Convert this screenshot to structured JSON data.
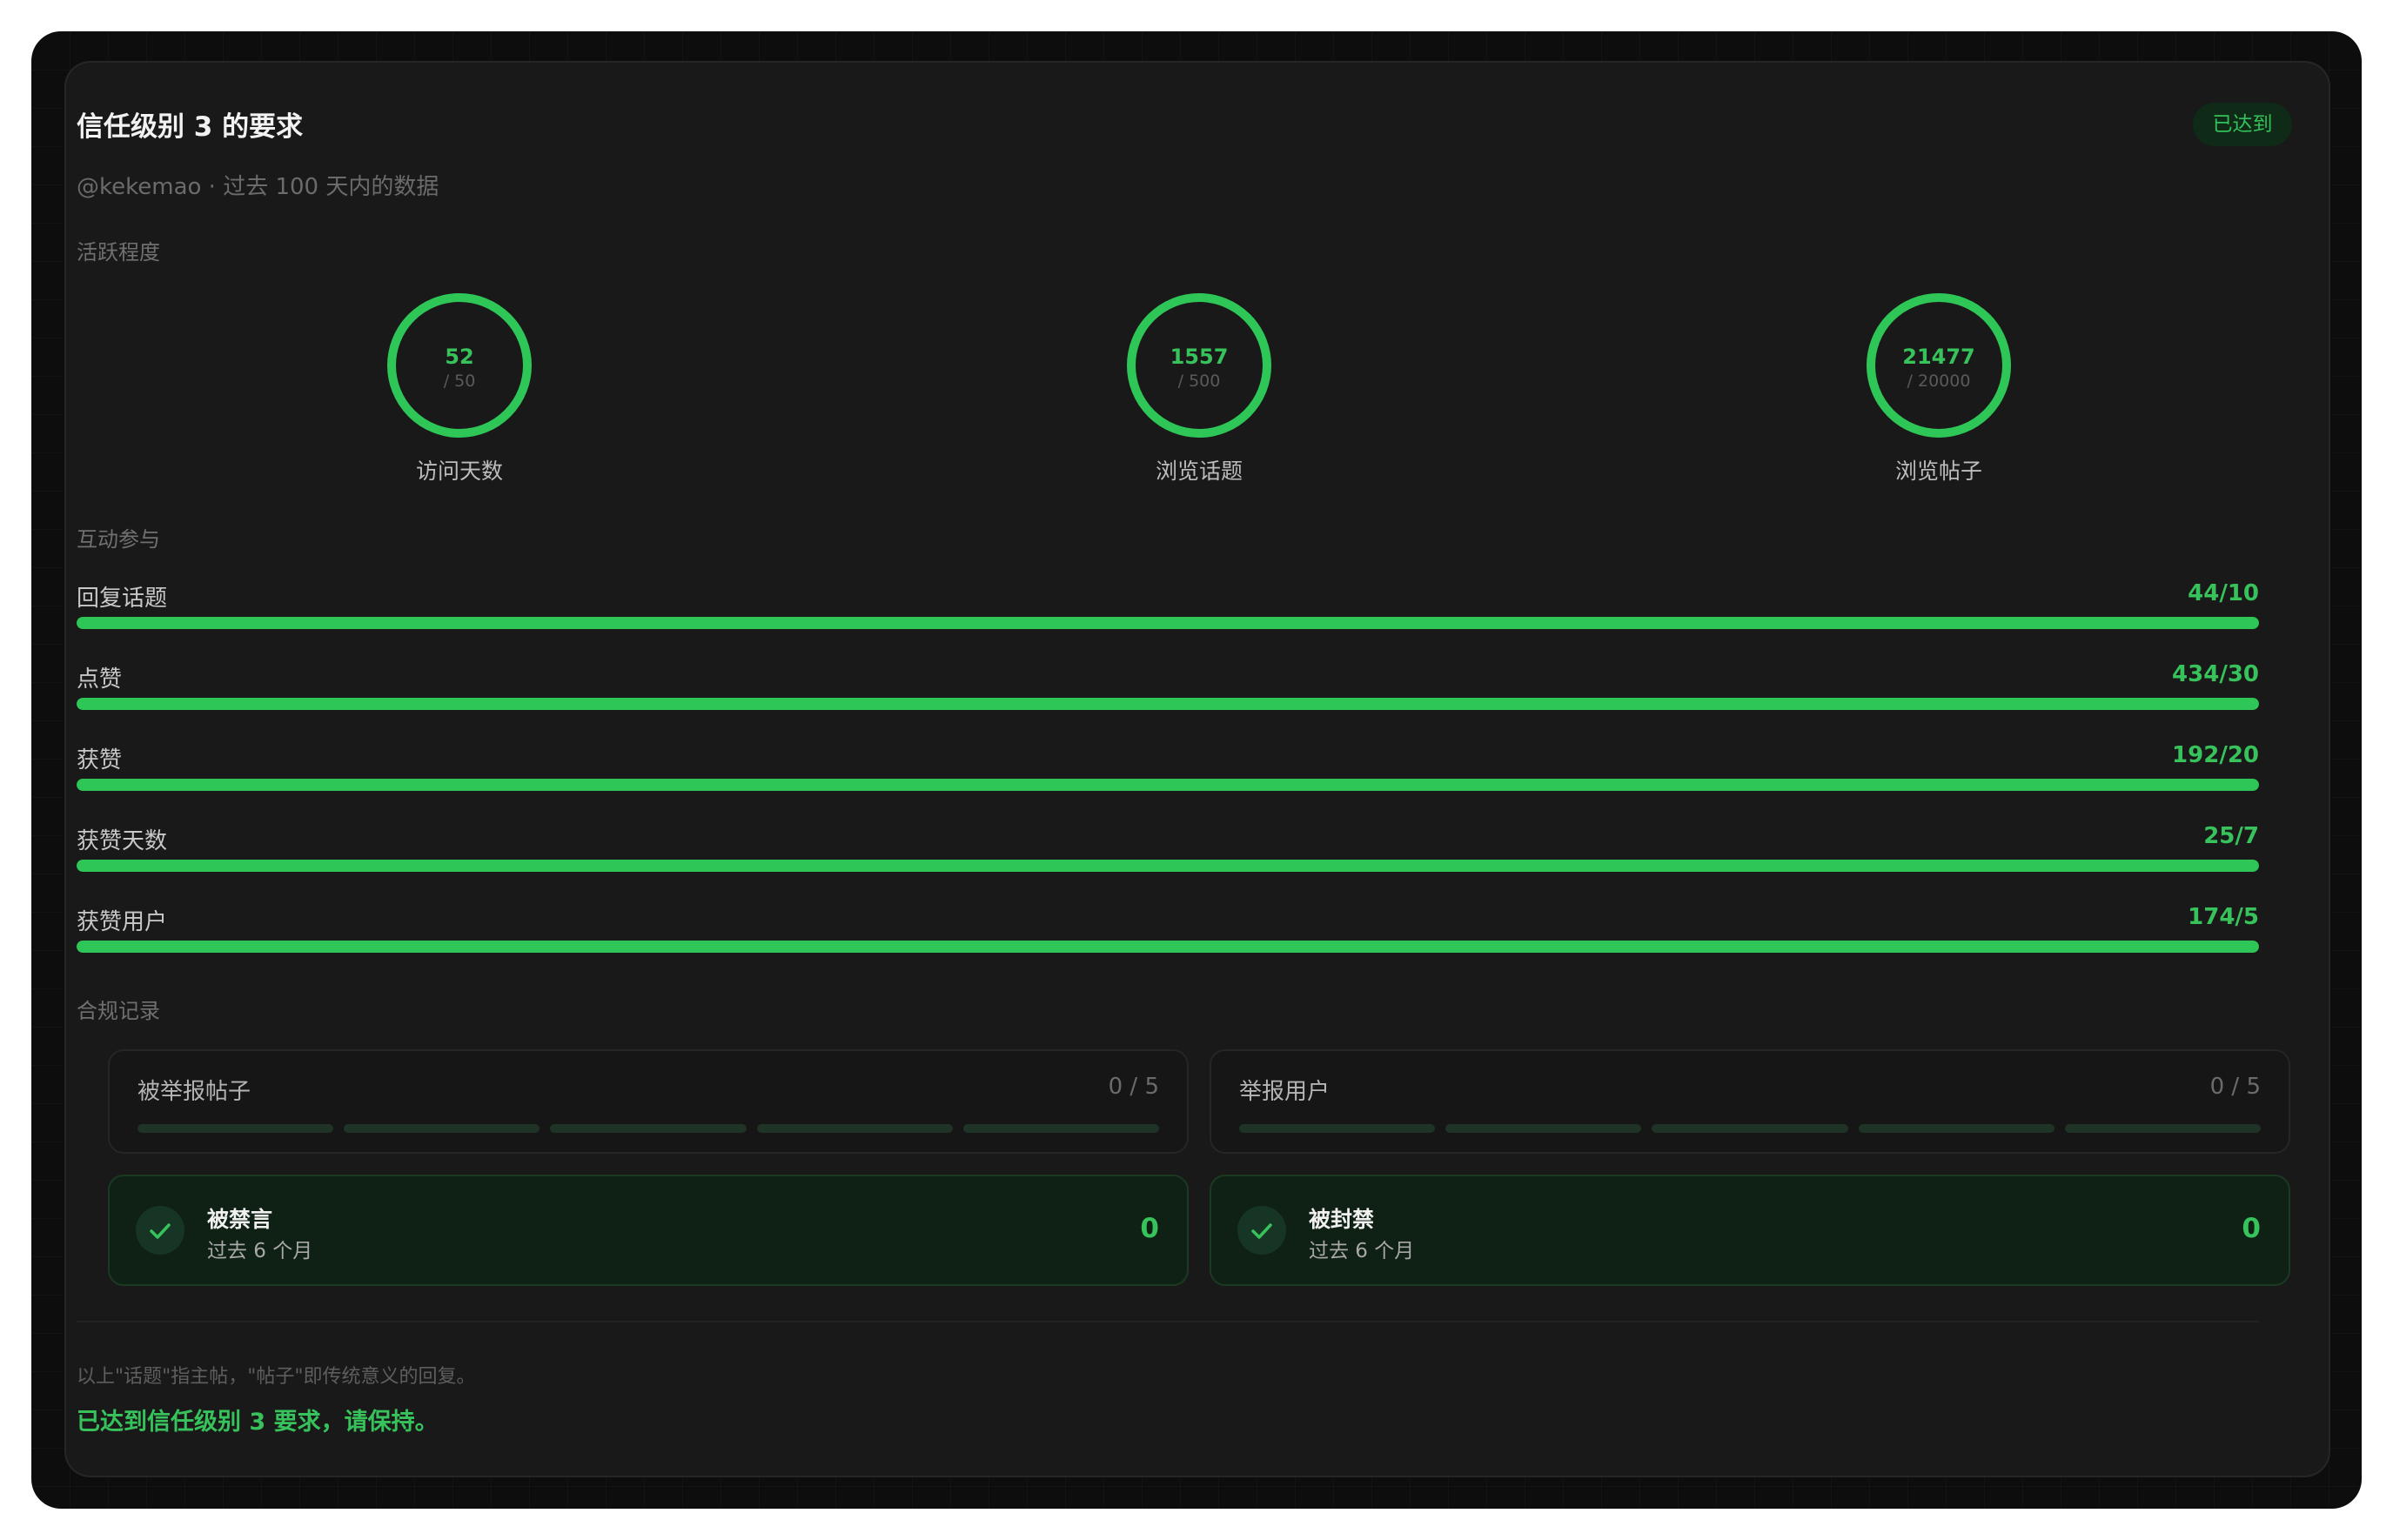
{
  "header": {
    "title": "信任级别 3 的要求",
    "badge": "已达到",
    "subtitle": "@kekemao · 过去 100 天内的数据"
  },
  "activity": {
    "label": "活跃程度",
    "rings": [
      {
        "value": "52",
        "goal": "/ 50",
        "label": "访问天数",
        "progress": 1.0
      },
      {
        "value": "1557",
        "goal": "/ 500",
        "label": "浏览话题",
        "progress": 1.0
      },
      {
        "value": "21477",
        "goal": "/ 20000",
        "label": "浏览帖子",
        "progress": 1.0
      }
    ]
  },
  "engagement": {
    "label": "互动参与",
    "bars": [
      {
        "name": "回复话题",
        "value": "44/10",
        "progress": 1.0
      },
      {
        "name": "点赞",
        "value": "434/30",
        "progress": 1.0
      },
      {
        "name": "获赞",
        "value": "192/20",
        "progress": 1.0
      },
      {
        "name": "获赞天数",
        "value": "25/7",
        "progress": 1.0
      },
      {
        "name": "获赞用户",
        "value": "174/5",
        "progress": 1.0
      }
    ]
  },
  "compliance": {
    "label": "合规记录",
    "flagged_posts": {
      "name": "被举报帖子",
      "value": "0 / 5"
    },
    "flagged_users": {
      "name": "举报用户",
      "value": "0 / 5"
    },
    "silenced": {
      "title": "被禁言",
      "sub": "过去 6 个月",
      "count": "0"
    },
    "suspended": {
      "title": "被封禁",
      "sub": "过去 6 个月",
      "count": "0"
    }
  },
  "footer": {
    "note": "以上\"话题\"指主帖，\"帖子\"即传统意义的回复。",
    "status": "已达到信任级别 3 要求，请保持。"
  },
  "colors": {
    "accent": "#2ec657",
    "card": "#191919",
    "background": "#0d0d0d"
  }
}
